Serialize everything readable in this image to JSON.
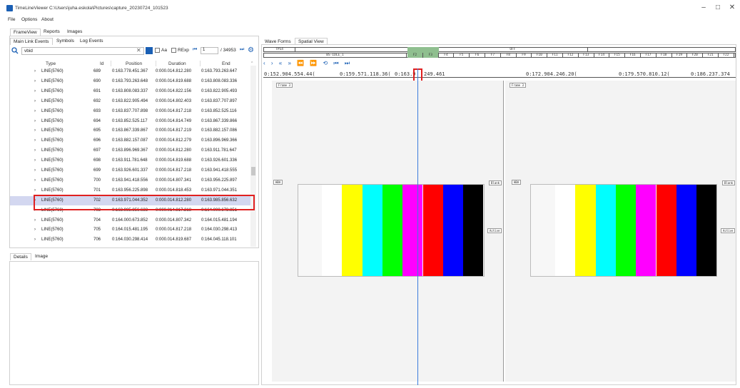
{
  "window": {
    "title": "TimeLineViewer C:\\Users\\juha.eskola\\Pictures\\capture_20230724_101523",
    "controls": [
      "–",
      "□",
      "✕"
    ]
  },
  "menu": [
    "File",
    "Options",
    "About"
  ],
  "top_tabs": [
    "FrameView",
    "Reports",
    "Images"
  ],
  "sub_tabs": [
    "Main Link Events",
    "Symbols",
    "Log Events"
  ],
  "search": {
    "value": "vbid",
    "aa": "Aa",
    "regexp": "RExp",
    "page": "1",
    "total": "/ 34953"
  },
  "columns": [
    "Type",
    "Id",
    "Position",
    "Duration",
    "End"
  ],
  "rows": [
    {
      "type": "LINE(5760)",
      "id": "689",
      "pos": "0:163.778.451.367",
      "dur": "0:000.014.812.280",
      "end": "0:163.793.263.647"
    },
    {
      "type": "LINE(5760)",
      "id": "690",
      "pos": "0:163.793.263.648",
      "dur": "0:000.014.819.688",
      "end": "0:163.808.083.336"
    },
    {
      "type": "LINE(5760)",
      "id": "691",
      "pos": "0:163.808.083.337",
      "dur": "0:000.014.822.156",
      "end": "0:163.822.905.493"
    },
    {
      "type": "LINE(5760)",
      "id": "692",
      "pos": "0:163.822.905.494",
      "dur": "0:000.014.802.403",
      "end": "0:163.837.707.897"
    },
    {
      "type": "LINE(5760)",
      "id": "693",
      "pos": "0:163.837.707.898",
      "dur": "0:000.014.817.218",
      "end": "0:163.852.525.116"
    },
    {
      "type": "LINE(5760)",
      "id": "694",
      "pos": "0:163.852.525.117",
      "dur": "0:000.014.814.749",
      "end": "0:163.867.339.866"
    },
    {
      "type": "LINE(5760)",
      "id": "695",
      "pos": "0:163.867.339.867",
      "dur": "0:000.014.817.219",
      "end": "0:163.882.157.086"
    },
    {
      "type": "LINE(5760)",
      "id": "696",
      "pos": "0:163.882.157.087",
      "dur": "0:000.014.812.279",
      "end": "0:163.896.969.366"
    },
    {
      "type": "LINE(5760)",
      "id": "697",
      "pos": "0:163.896.969.367",
      "dur": "0:000.014.812.280",
      "end": "0:163.911.781.647"
    },
    {
      "type": "LINE(5760)",
      "id": "698",
      "pos": "0:163.911.781.648",
      "dur": "0:000.014.819.688",
      "end": "0:163.926.601.336"
    },
    {
      "type": "LINE(5760)",
      "id": "699",
      "pos": "0:163.926.601.337",
      "dur": "0:000.014.817.218",
      "end": "0:163.941.418.555"
    },
    {
      "type": "LINE(5760)",
      "id": "700",
      "pos": "0:163.941.418.556",
      "dur": "0:000.014.807.341",
      "end": "0:163.956.225.897"
    },
    {
      "type": "LINE(5760)",
      "id": "701",
      "pos": "0:163.956.225.898",
      "dur": "0:000.014.818.453",
      "end": "0:163.971.044.351"
    },
    {
      "type": "LINE(5760)",
      "id": "702",
      "pos": "0:163.971.044.352",
      "dur": "0:000.014.812.280",
      "end": "0:163.985.856.632"
    },
    {
      "type": "LINE(5760)",
      "id": "703",
      "pos": "0:163.985.856.633",
      "dur": "0:000.014.817.218",
      "end": "0:164.000.673.851"
    },
    {
      "type": "LINE(5760)",
      "id": "704",
      "pos": "0:164.000.673.852",
      "dur": "0:000.014.807.342",
      "end": "0:164.015.481.194"
    },
    {
      "type": "LINE(5760)",
      "id": "705",
      "pos": "0:164.015.481.195",
      "dur": "0:000.014.817.218",
      "end": "0:164.030.298.413"
    },
    {
      "type": "LINE(5760)",
      "id": "706",
      "pos": "0:164.030.298.414",
      "dur": "0:000.014.819.687",
      "end": "0:164.045.118.101"
    }
  ],
  "selected_row_index": 13,
  "bottom_tabs": [
    "Details",
    "Image"
  ],
  "right_tabs": [
    "Wave Forms",
    "Spatial View"
  ],
  "tracks": {
    "top_left": "TPS4",
    "idle": "BS-IDLE_1",
    "off": "OFF",
    "frames": [
      "F2",
      "F3",
      "F4",
      "F5",
      "F6",
      "F7",
      "F8",
      "F9",
      "F10",
      "F11",
      "F12",
      "F13",
      "F14",
      "F15",
      "F16",
      "F17",
      "F18",
      "F19",
      "F20",
      "F21",
      "F22"
    ]
  },
  "timestamps": [
    "0:152.904.554.44(",
    "0:159.571.118.36(",
    "0:163.9",
    "249.461",
    "0:172.904.246.20(",
    "0:179.570.810.12(",
    "0:186.237.374"
  ],
  "labels": {
    "frame": "Frame 3",
    "hba": "HBA",
    "blank": "Blank",
    "active": "Active"
  },
  "colors": {
    "accent": "#1a5fb4",
    "highlight": "#e02020",
    "selection": "#d3d7f0",
    "bars": [
      "#ffffff",
      "#ffff00",
      "#00ffff",
      "#00ff00",
      "#ff00ff",
      "#ff0000",
      "#0000ff",
      "#000000"
    ]
  }
}
